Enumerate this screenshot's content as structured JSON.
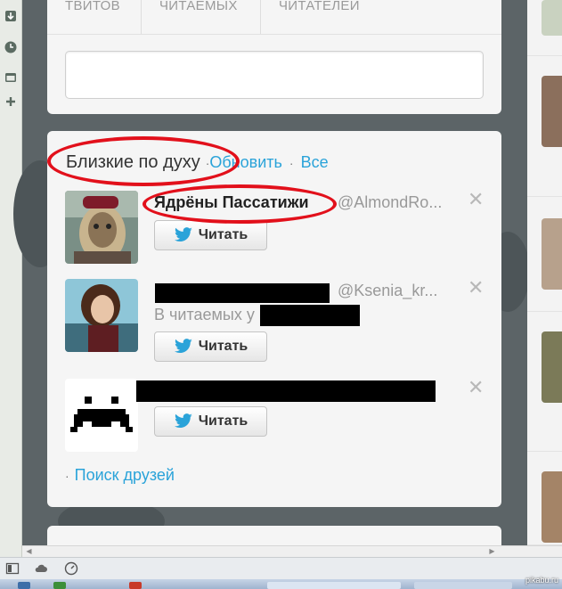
{
  "stats": {
    "tweets_label": "ТВИТОВ",
    "following_label": "ЧИТАЕМЫХ",
    "followers_label": "ЧИТАТЕЛЕЙ"
  },
  "compose": {
    "placeholder": ""
  },
  "who_to_follow": {
    "title": "Близкие по духу",
    "separator": "·",
    "refresh_label": "Обновить",
    "all_label": "Все",
    "users": [
      {
        "name": "Ядрёны Пассатижи",
        "handle": "@AlmondRo...",
        "subtext": "",
        "follow_label": "Читать"
      },
      {
        "name": "",
        "handle": "@Ksenia_kr...",
        "subtext": "В читаемых у",
        "follow_label": "Читать"
      },
      {
        "name": "",
        "handle": "",
        "subtext": "",
        "follow_label": "Читать"
      }
    ],
    "find_friends_label": "Поиск друзей"
  },
  "watermark": "pikabu.ru",
  "colors": {
    "link": "#2aa3d9",
    "annotation_ring": "#e2101b",
    "twitter_bird": "#2aa3d9",
    "background": "#5c6467"
  },
  "icons": [
    "download-icon",
    "clock-icon",
    "window-icon",
    "plus-icon",
    "twitter-bird-icon",
    "close-icon",
    "cloud-icon",
    "gauge-icon"
  ]
}
